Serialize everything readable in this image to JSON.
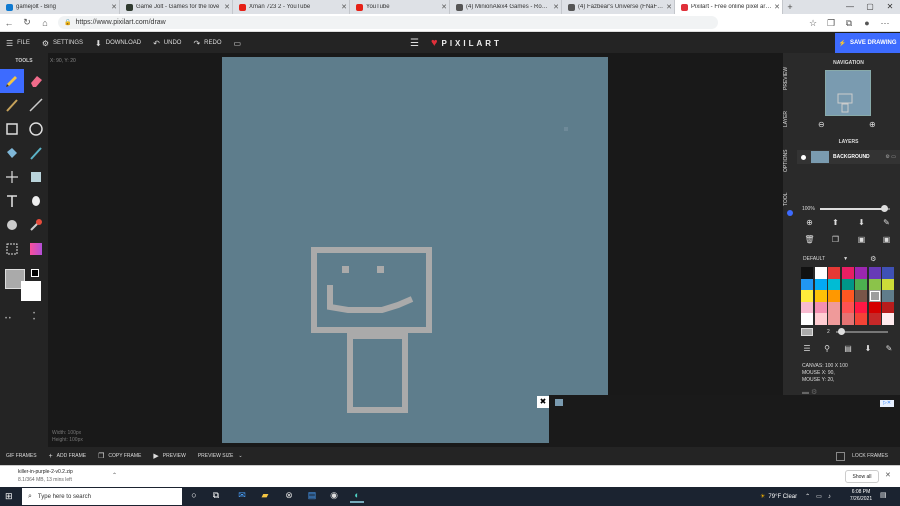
{
  "browser": {
    "tabs": [
      {
        "label": "gamejolt - Bing",
        "active": false,
        "color": "#0f7ad1"
      },
      {
        "label": "Game Jolt - Games for the love",
        "active": false,
        "color": "#2f3a2f"
      },
      {
        "label": "Xman 723 2 - YouTube",
        "active": false,
        "color": "#e62117"
      },
      {
        "label": "YouTube",
        "active": false,
        "color": "#e62117"
      },
      {
        "label": "(4) MinionAlex4 Games - Roblox",
        "active": false,
        "color": "#555555"
      },
      {
        "label": "(4) Fazbear's Universe (FNaF RP)",
        "active": false,
        "color": "#555555"
      },
      {
        "label": "Pixilart - Free online pixel art dra",
        "active": true,
        "color": "#e0303a"
      }
    ],
    "url": "https://www.pixilart.com/draw"
  },
  "app": {
    "menu": {
      "file": "FILE",
      "settings": "SETTINGS",
      "download": "DOWNLOAD",
      "undo": "UNDO",
      "redo": "REDO"
    },
    "brand": "PIXILART",
    "save_label": "SAVE DRAWING",
    "tools_title": "TOOLS",
    "cursor_coord": "X: 90, Y: 20",
    "canvas_info": {
      "width": "Width: 100px",
      "height": "Height: 100px"
    },
    "accent": "#3d6bff",
    "canvas_color": "#5e7d8c",
    "stroke_color": "#aaaaaa"
  },
  "right_panel": {
    "vtabs": [
      "PREVIEW",
      "LAYER",
      "OPTIONS",
      "TOOL"
    ],
    "navigation_title": "NAVIGATION",
    "layers_title": "LAYERS",
    "layer_name": "BACKGROUND",
    "zoom_label": "100%",
    "palette_name": "DEFAULT",
    "brush_size": "2",
    "info": {
      "canvas": "CANVAS: 100 X 100",
      "mouse_x": "MOUSE X: 90,",
      "mouse_y": "MOUSE Y: 20,"
    },
    "palette_colors": [
      "#111111",
      "#ffffff",
      "#e53935",
      "#e91e63",
      "#9c27b0",
      "#673ab7",
      "#3f51b5",
      "#2196f3",
      "#03a9f4",
      "#00bcd4",
      "#009688",
      "#4caf50",
      "#8bc34a",
      "#cddc39",
      "#ffeb3b",
      "#ffc107",
      "#ff9800",
      "#ff5722",
      "#795548",
      "#9e9e9e",
      "#607d8b",
      "#f8bbd0",
      "#f48fb1",
      "#ef9a9a",
      "#ff5252",
      "#ff1744",
      "#d50000",
      "#b71c1c",
      "#ffffff",
      "#ffcdd2",
      "#ef9a9a",
      "#e57373",
      "#f44336",
      "#c62828",
      "#ffebee"
    ]
  },
  "frames": {
    "gif_frames": "GIF FRAMES",
    "add_frame": "ADD FRAME",
    "copy_frame": "COPY FRAME",
    "preview": "PREVIEW",
    "preview_size": "PREVIEW SIZE",
    "lock_frames": "LOCK FRAMES"
  },
  "downloads": {
    "file": "killer-in-purple-2-v0.2.zip",
    "status": "8.1/364 MB, 13 mins left",
    "show_all": "Show all"
  },
  "taskbar": {
    "search_placeholder": "Type here to search",
    "weather": "79°F  Clear",
    "time": "6:08 PM",
    "date": "7/26/2021"
  }
}
